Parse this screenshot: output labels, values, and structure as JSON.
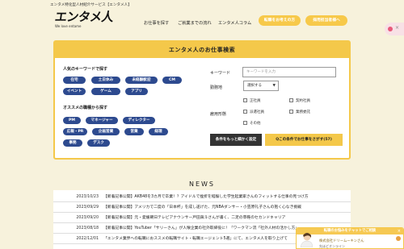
{
  "header": {
    "tagline": "エンタメ特化型人材紹介サービス【エンタメ人】",
    "logo_text": "エンタメ人",
    "logo_sub": "We love entame",
    "nav": [
      "お仕事を探す",
      "ご就業までの流れ",
      "エンタメ人コラム"
    ],
    "cta_primary": "転職をお考えの方",
    "cta_secondary": "採用担当者様へ"
  },
  "search": {
    "title": "エンタメ人のお仕事検索",
    "popular_label": "人気のキーワードで探す",
    "popular_keywords": [
      "在宅",
      "土日休み",
      "未経験歓迎",
      "CM",
      "イベント",
      "ゲーム",
      "アプリ"
    ],
    "role_label": "オススメの職種から探す",
    "roles": [
      "PM",
      "マネージャー",
      "ディレクター",
      "広報・PR",
      "企画営業",
      "営業",
      "経理",
      "事務",
      "デスク"
    ],
    "keyword_label": "キーワード",
    "keyword_placeholder": "キーワードを入力",
    "area_label": "勤務地",
    "area_select": "選択する",
    "employment_label": "雇用形態",
    "employment_options": [
      "正社員",
      "契約社員",
      "派遣社員",
      "業務委託",
      "その他"
    ],
    "detail_button": "条件をもっと細かく設定",
    "submit_button": "Qこの条件でお仕事をさがす(57)"
  },
  "news": {
    "title": "NEWS",
    "items": [
      {
        "date": "2023/10/23",
        "text": "【新着記事公開】AKB48を3カ月で卒業！？アイドルで挫折を経験した学生起業家さんのフィットする仕事の見つけ方"
      },
      {
        "date": "2023/09/29",
        "text": "【新着記事公開】アメリカで二度の「日本杯」を成し遂げた、元NBAダンサー・小笠原礼子さんの抱く心なき挑戦"
      },
      {
        "date": "2023/09/20",
        "text": "【新着記事公開】元・愛媛朝日テレビアナウンサー戸田眞斗さんが書く、二足の草鞋のセカンドキャリア"
      },
      {
        "date": "2023/08/18",
        "text": "【新着記事公開】YouTuber「サリーさん」が人懐企業の社外取締役に！「ワークマン流「社外人材の活かし方」"
      },
      {
        "date": "2022/12/01",
        "text": "「エンタメ業界への転職におススメの転職サイト・転職エージェント5選」にて、エンタメ人を取り上げて"
      }
    ]
  },
  "chat": {
    "header": "転職のお悩みをチャットでご相談",
    "name": "株式会社ドリームーキンさん",
    "sub": "先ほどオンライン"
  },
  "colors": {
    "accent_yellow": "#f4c84a",
    "chip_blue": "#2d4a8f",
    "background": "#f7f2dc"
  }
}
